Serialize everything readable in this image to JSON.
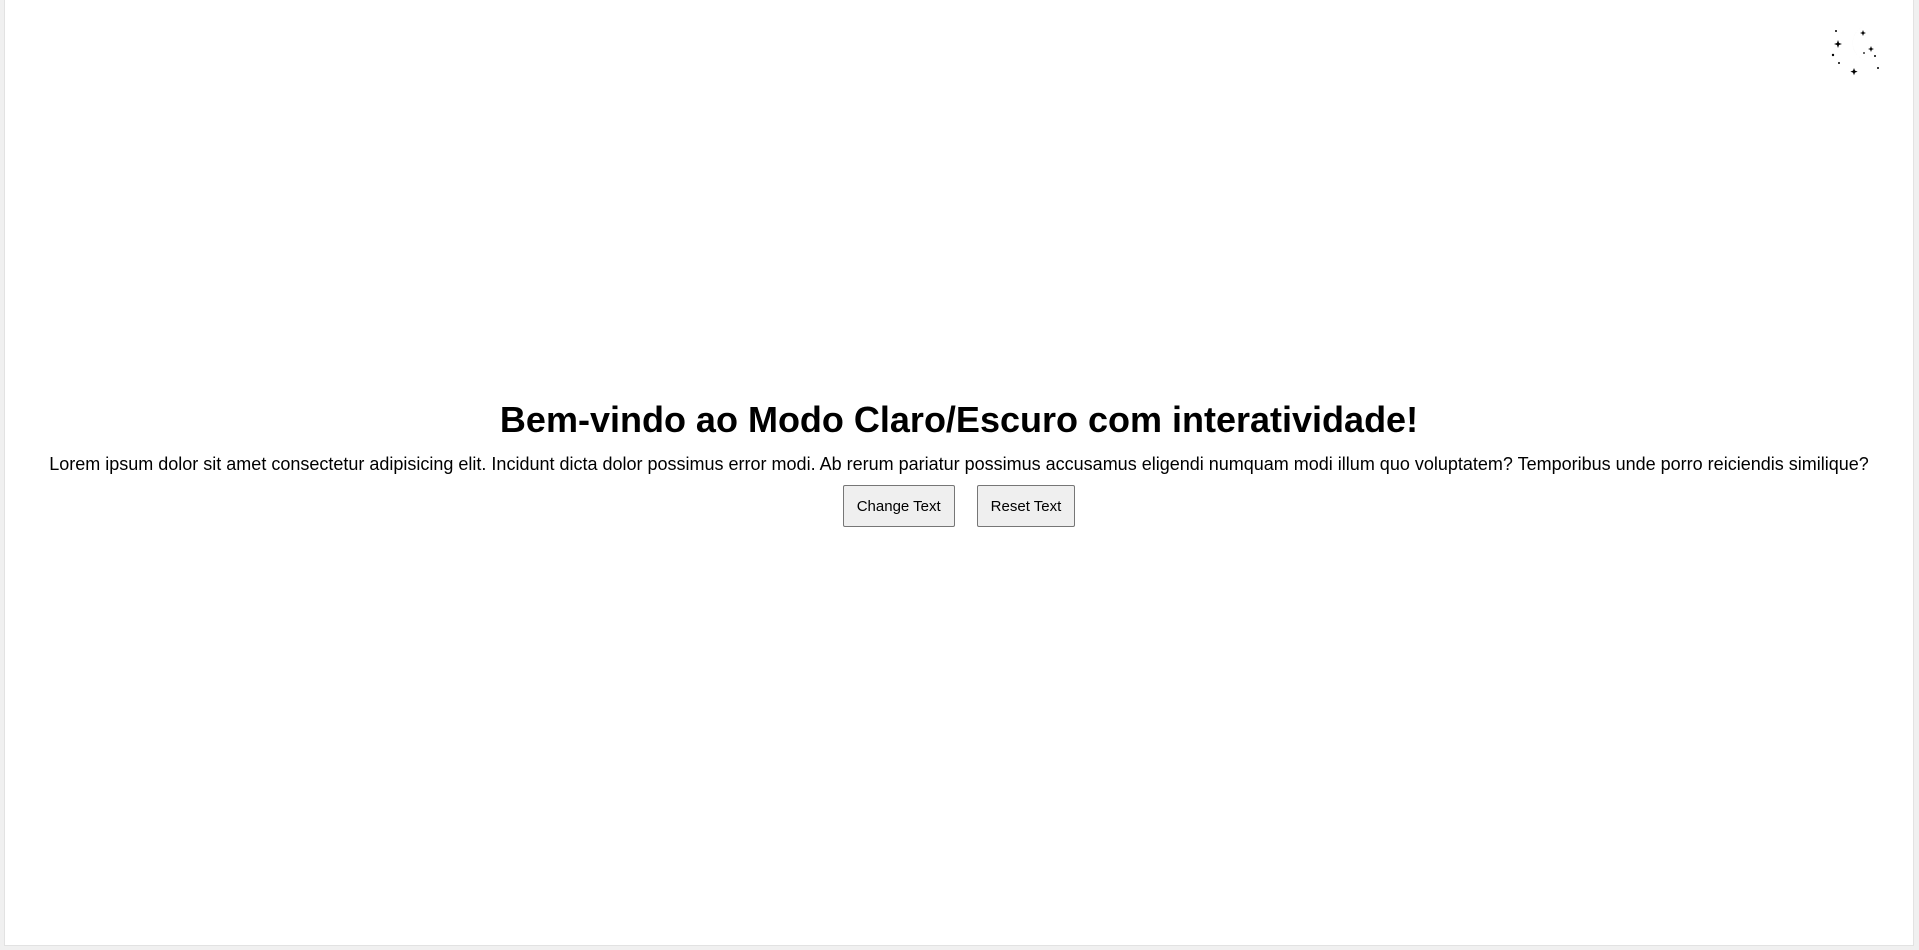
{
  "theme_toggle": {
    "icon": "moon-stars-icon",
    "color": "#000000"
  },
  "main": {
    "title": "Bem-vindo ao Modo Claro/Escuro com interatividade!",
    "paragraph": "Lorem ipsum dolor sit amet consectetur adipisicing elit. Incidunt dicta dolor possimus error modi. Ab rerum pariatur possimus accusamus eligendi numquam modi illum quo voluptatem? Temporibus unde porro reiciendis similique?",
    "buttons": {
      "change_label": "Change Text",
      "reset_label": "Reset Text"
    }
  },
  "colors": {
    "background": "#ffffff",
    "text": "#000000",
    "button_bg": "#efefef",
    "button_border": "#767676"
  }
}
